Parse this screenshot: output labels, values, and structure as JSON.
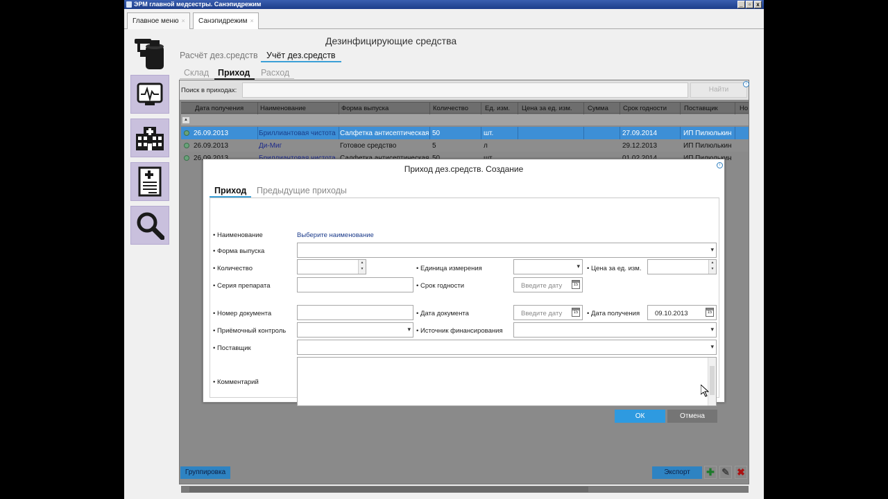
{
  "window": {
    "title": "ЭРМ главной медсестры. Санэпидрежим",
    "controls": [
      "_",
      "▫",
      "x"
    ]
  },
  "doc_tabs": [
    {
      "label": "Главное меню",
      "close": "×"
    },
    {
      "label": "Санэпидрежим",
      "close": "×"
    }
  ],
  "page_title": "Дезинфицирующие средства",
  "top_tabs": [
    "Расчёт дез.средств",
    "Учёт дез.средств"
  ],
  "sub_tabs": [
    "Склад",
    "Приход",
    "Расход"
  ],
  "search": {
    "label": "Поиск в приходах:",
    "value": "",
    "button": "Найти"
  },
  "grid": {
    "columns": [
      "Дата получения",
      "Наименование",
      "Форма выпуска",
      "Количество",
      "Ед. изм.",
      "Цена за ед. изм.",
      "Сумма",
      "Срок годности",
      "Поставщик",
      "Но"
    ],
    "rows": [
      {
        "date": "26.09.2013",
        "name": "Бриллиантовая чистота",
        "form": "Салфетка антисептическая",
        "qty": "50",
        "unit": "шт.",
        "price": "",
        "sum": "",
        "expiry": "27.09.2014",
        "supplier": "ИП Пилюлькин",
        "selected": true
      },
      {
        "date": "26.09.2013",
        "name": "Ди-Миг",
        "form": "Готовое средство",
        "qty": "5",
        "unit": "л",
        "price": "",
        "sum": "",
        "expiry": "29.12.2013",
        "supplier": "ИП Пилюлькин",
        "selected": false
      },
      {
        "date": "26.09.2013",
        "name": "Бриллиантовая чистота",
        "form": "Салфетка антисептическая",
        "qty": "50",
        "unit": "шт.",
        "price": "",
        "sum": "",
        "expiry": "01.02.2014",
        "supplier": "ИП Пилюлькин",
        "selected": false
      }
    ]
  },
  "bottom": {
    "grouping": "Группировка",
    "export": "Экспорт",
    "add": "✚",
    "edit": "✎",
    "delete": "✖"
  },
  "modal": {
    "title": "Приход дез.средств. Создание",
    "tabs": [
      "Приход",
      "Предыдущие приходы"
    ],
    "labels": {
      "name": "• Наименование",
      "form": "• Форма выпуска",
      "qty": "• Количество",
      "unit": "• Единица измерения",
      "price": "• Цена за ед. изм.",
      "series": "• Серия препарата",
      "expiry": "• Срок годности",
      "doc_num": "• Номер документа",
      "doc_date": "• Дата документа",
      "recv_date": "• Дата получения",
      "control": "• Приёмочный контроль",
      "funding": "• Источник финансирования",
      "supplier": "• Поставщик",
      "comment": "• Комментарий"
    },
    "select_name_link": "Выберите наименование",
    "date_placeholder": "Введите дату",
    "recv_date_value": "09.10.2013",
    "calendar_day": "15",
    "ok": "ОК",
    "cancel": "Отмена"
  },
  "colors": {
    "accent": "#3a9fd6",
    "selected_row": "#3d8fd6",
    "sidebar_tile": "#c9c0dd"
  }
}
